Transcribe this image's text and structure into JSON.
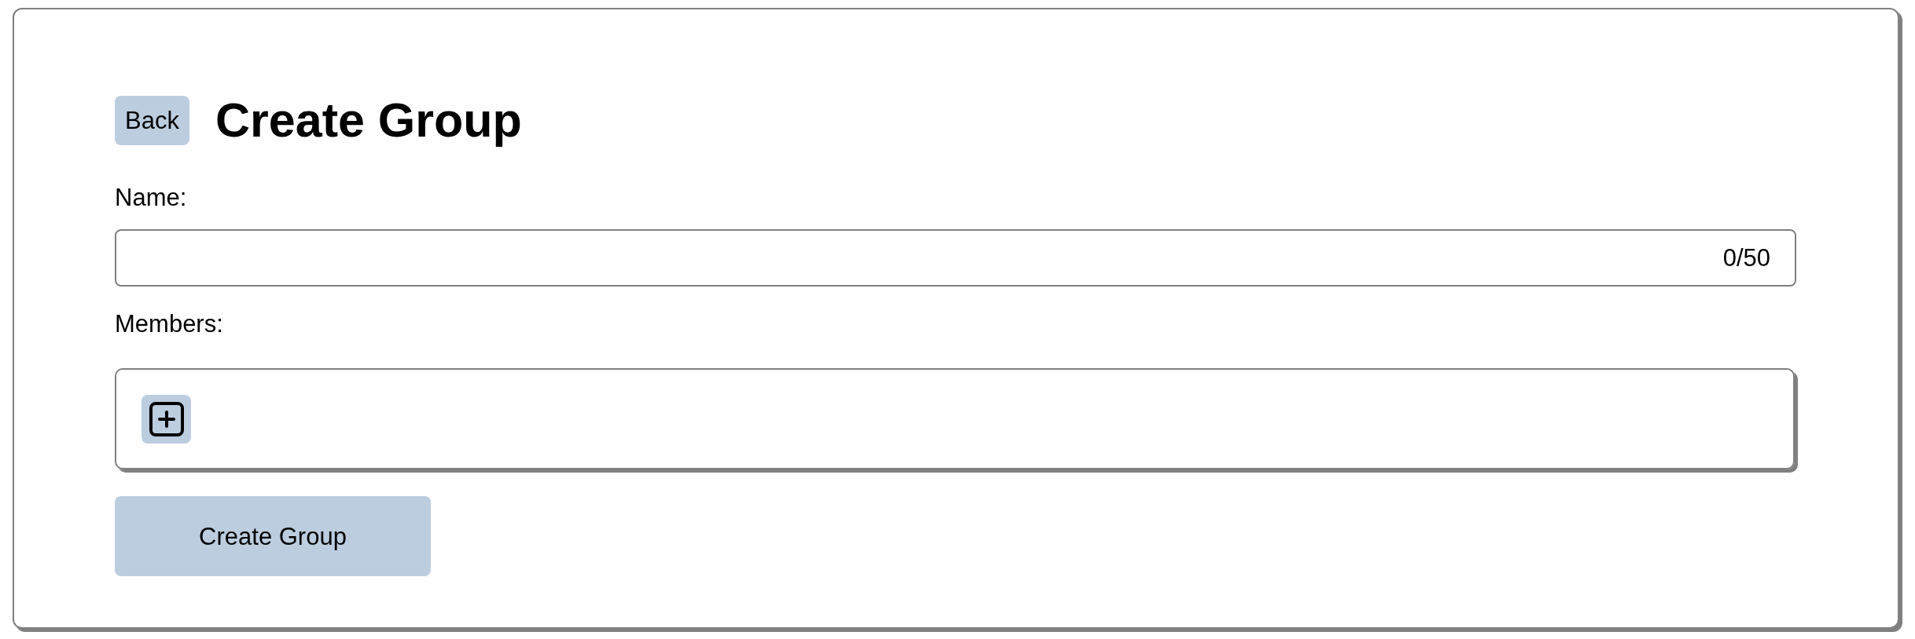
{
  "back_button": {
    "label": "Back"
  },
  "title": "Create Group",
  "name_field": {
    "label": "Name:",
    "counter": "0/50"
  },
  "members_field": {
    "label": "Members:"
  },
  "submit_button": {
    "label": "Create Group"
  }
}
